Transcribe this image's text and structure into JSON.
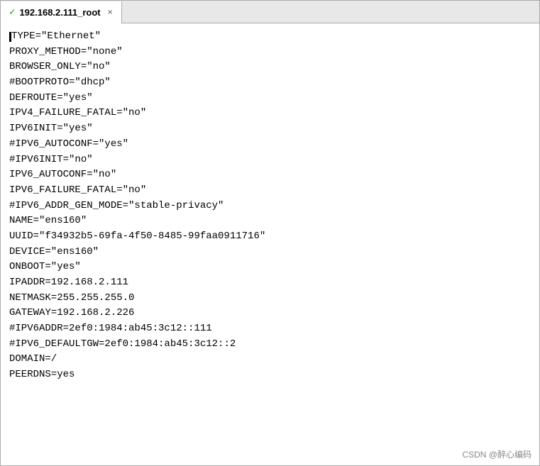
{
  "tab": {
    "check_icon": "✓",
    "title": "192.168.2.111_root",
    "close_label": "×"
  },
  "code": {
    "lines": [
      "TYPE=\"Ethernet\"",
      "PROXY_METHOD=\"none\"",
      "BROWSER_ONLY=\"no\"",
      "#BOOTPROTO=\"dhcp\"",
      "DEFROUTE=\"yes\"",
      "IPV4_FAILURE_FATAL=\"no\"",
      "IPV6INIT=\"yes\"",
      "#IPV6_AUTOCONF=\"yes\"",
      "#IPV6INIT=\"no\"",
      "IPV6_AUTOCONF=\"no\"",
      "IPV6_FAILURE_FATAL=\"no\"",
      "#IPV6_ADDR_GEN_MODE=\"stable-privacy\"",
      "NAME=\"ens160\"",
      "UUID=\"f34932b5-69fa-4f50-8485-99faa0911716\"",
      "DEVICE=\"ens160\"",
      "ONBOOT=\"yes\"",
      "IPADDR=192.168.2.111",
      "NETMASK=255.255.255.0",
      "GATEWAY=192.168.2.226",
      "#IPV6ADDR=2ef0:1984:ab45:3c12::111",
      "#IPV6_DEFAULTGW=2ef0:1984:ab45:3c12::2",
      "DOMAIN=/",
      "PEERDNS=yes"
    ]
  },
  "watermark": {
    "text": "CSDN @醉心编码"
  }
}
